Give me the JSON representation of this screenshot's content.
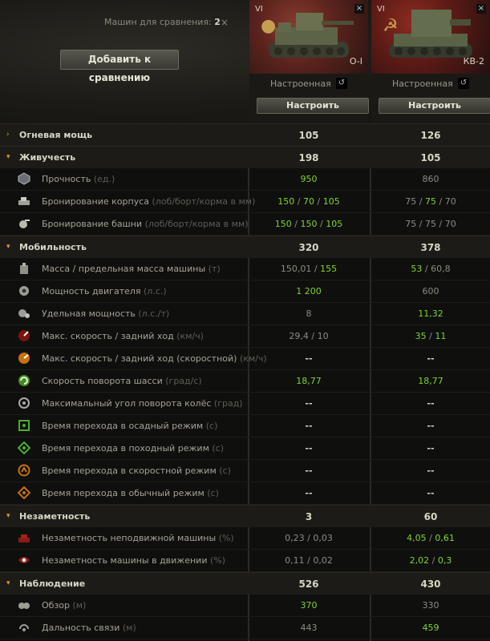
{
  "header": {
    "compare_label": "Машин для сравнения:",
    "compare_count": "2",
    "close_glyph": "×",
    "add_button": "Добавить к сравнению"
  },
  "vehicles": [
    {
      "tier": "VI",
      "name": "O-I",
      "status": "Настроенная",
      "button": "Настроить",
      "nation_glyph": "●",
      "close_glyph": "×",
      "reset_glyph": "↺"
    },
    {
      "tier": "VI",
      "name": "КВ-2",
      "status": "Настроенная",
      "button": "Настроить",
      "nation_glyph": "☭",
      "close_glyph": "×",
      "reset_glyph": "↺"
    }
  ],
  "rows": [
    {
      "type": "sec",
      "arrow": "›",
      "name": "Огневая мощь",
      "v1": "105",
      "v2": "126",
      "g1": false,
      "g2": true
    },
    {
      "type": "sec",
      "arrow": "▾",
      "name": "Живучесть",
      "v1": "198",
      "v2": "105",
      "g1": true,
      "g2": false
    },
    {
      "type": "sub",
      "icon": "durability-icon",
      "name": "Прочность",
      "unit": "(ед.)",
      "v1": [
        [
          "950",
          true
        ]
      ],
      "v2": [
        [
          "860",
          false
        ]
      ]
    },
    {
      "type": "sub",
      "icon": "hull-armor-icon",
      "name": "Бронирование корпуса",
      "unit": "(лоб/борт/корма в мм)",
      "v1": [
        [
          "150",
          true
        ],
        [
          " / ",
          false
        ],
        [
          "70",
          true
        ],
        [
          " / ",
          false
        ],
        [
          "105",
          true
        ]
      ],
      "v2": [
        [
          "75",
          false
        ],
        [
          " / ",
          false
        ],
        [
          "75",
          true
        ],
        [
          " / ",
          false
        ],
        [
          "70",
          false
        ]
      ]
    },
    {
      "type": "sub",
      "icon": "turret-armor-icon",
      "name": "Бронирование башни",
      "unit": "(лоб/борт/корма в мм)",
      "v1": [
        [
          "150",
          true
        ],
        [
          " / ",
          false
        ],
        [
          "150",
          true
        ],
        [
          " / ",
          false
        ],
        [
          "105",
          true
        ]
      ],
      "v2": [
        [
          "75 / 75 / 70",
          false
        ]
      ]
    },
    {
      "type": "sec",
      "arrow": "▾",
      "name": "Мобильность",
      "v1": "320",
      "v2": "378",
      "g1": false,
      "g2": true
    },
    {
      "type": "sub",
      "icon": "weight-icon",
      "name": "Масса / предельная масса машины",
      "unit": "(т)",
      "v1": [
        [
          "150,01 / ",
          false
        ],
        [
          "155",
          true
        ]
      ],
      "v2": [
        [
          "53",
          true
        ],
        [
          " / 60,8",
          false
        ]
      ]
    },
    {
      "type": "sub",
      "icon": "engine-icon",
      "name": "Мощность двигателя",
      "unit": "(л.с.)",
      "v1": [
        [
          "1 200",
          true
        ]
      ],
      "v2": [
        [
          "600",
          false
        ]
      ]
    },
    {
      "type": "sub",
      "icon": "specific-power-icon",
      "name": "Удельная мощность",
      "unit": "(л.с./т)",
      "v1": [
        [
          "8",
          false
        ]
      ],
      "v2": [
        [
          "11,32",
          true
        ]
      ]
    },
    {
      "type": "sub",
      "icon": "speed-icon",
      "name": "Макс. скорость / задний ход",
      "unit": "(км/ч)",
      "v1": [
        [
          "29,4 / 10",
          false
        ]
      ],
      "v2": [
        [
          "35",
          true
        ],
        [
          " / ",
          false
        ],
        [
          "11",
          true
        ]
      ]
    },
    {
      "type": "sub",
      "icon": "speed-mode-speed-icon",
      "name": "Макс. скорость / задний ход (скоростной)",
      "unit": "(км/ч)",
      "v1": [
        [
          "--",
          false
        ]
      ],
      "v2": [
        [
          "--",
          false
        ]
      ],
      "dash": true
    },
    {
      "type": "sub",
      "icon": "traverse-icon",
      "name": "Скорость поворота шасси",
      "unit": "(град/с)",
      "v1": [
        [
          "18,77",
          true
        ]
      ],
      "v2": [
        [
          "18,77",
          true
        ]
      ]
    },
    {
      "type": "sub",
      "icon": "wheel-angle-icon",
      "name": "Максимальный угол поворота колёс",
      "unit": "(град)",
      "v1": [
        [
          "--",
          false
        ]
      ],
      "v2": [
        [
          "--",
          false
        ]
      ],
      "dash": true
    },
    {
      "type": "sub",
      "icon": "siege-mode-icon",
      "name": "Время перехода в осадный режим",
      "unit": "(с)",
      "v1": [
        [
          "--",
          false
        ]
      ],
      "v2": [
        [
          "--",
          false
        ]
      ],
      "dash": true
    },
    {
      "type": "sub",
      "icon": "travel-mode-icon",
      "name": "Время перехода в походный режим",
      "unit": "(с)",
      "v1": [
        [
          "--",
          false
        ]
      ],
      "v2": [
        [
          "--",
          false
        ]
      ],
      "dash": true
    },
    {
      "type": "sub",
      "icon": "speed-mode-icon",
      "name": "Время перехода в скоростной режим",
      "unit": "(с)",
      "v1": [
        [
          "--",
          false
        ]
      ],
      "v2": [
        [
          "--",
          false
        ]
      ],
      "dash": true
    },
    {
      "type": "sub",
      "icon": "normal-mode-icon",
      "name": "Время перехода в обычный режим",
      "unit": "(с)",
      "v1": [
        [
          "--",
          false
        ]
      ],
      "v2": [
        [
          "--",
          false
        ]
      ],
      "dash": true
    },
    {
      "type": "sec",
      "arrow": "▾",
      "name": "Незаметность",
      "v1": "3",
      "v2": "60",
      "g1": false,
      "g2": true
    },
    {
      "type": "sub",
      "icon": "stationary-camo-icon",
      "name": "Незаметность неподвижной машины",
      "unit": "(%)",
      "v1": [
        [
          "0,23 / 0,03",
          false
        ]
      ],
      "v2": [
        [
          "4,05",
          true
        ],
        [
          " / ",
          false
        ],
        [
          "0,61",
          true
        ]
      ]
    },
    {
      "type": "sub",
      "icon": "moving-camo-icon",
      "name": "Незаметность машины в движении",
      "unit": "(%)",
      "v1": [
        [
          "0,11 / 0,02",
          false
        ]
      ],
      "v2": [
        [
          "2,02",
          true
        ],
        [
          " / ",
          false
        ],
        [
          "0,3",
          true
        ]
      ]
    },
    {
      "type": "sec",
      "arrow": "▾",
      "name": "Наблюдение",
      "v1": "526",
      "v2": "430",
      "g1": true,
      "g2": false
    },
    {
      "type": "sub",
      "icon": "view-range-icon",
      "name": "Обзор",
      "unit": "(м)",
      "v1": [
        [
          "370",
          true
        ]
      ],
      "v2": [
        [
          "330",
          false
        ]
      ]
    },
    {
      "type": "sub",
      "icon": "radio-range-icon",
      "name": "Дальность связи",
      "unit": "(м)",
      "v1": [
        [
          "443",
          false
        ]
      ],
      "v2": [
        [
          "459",
          true
        ]
      ]
    }
  ],
  "colors": {
    "good": "#7fd32a",
    "accent": "#e09a25",
    "text": "#d8d5c5"
  }
}
